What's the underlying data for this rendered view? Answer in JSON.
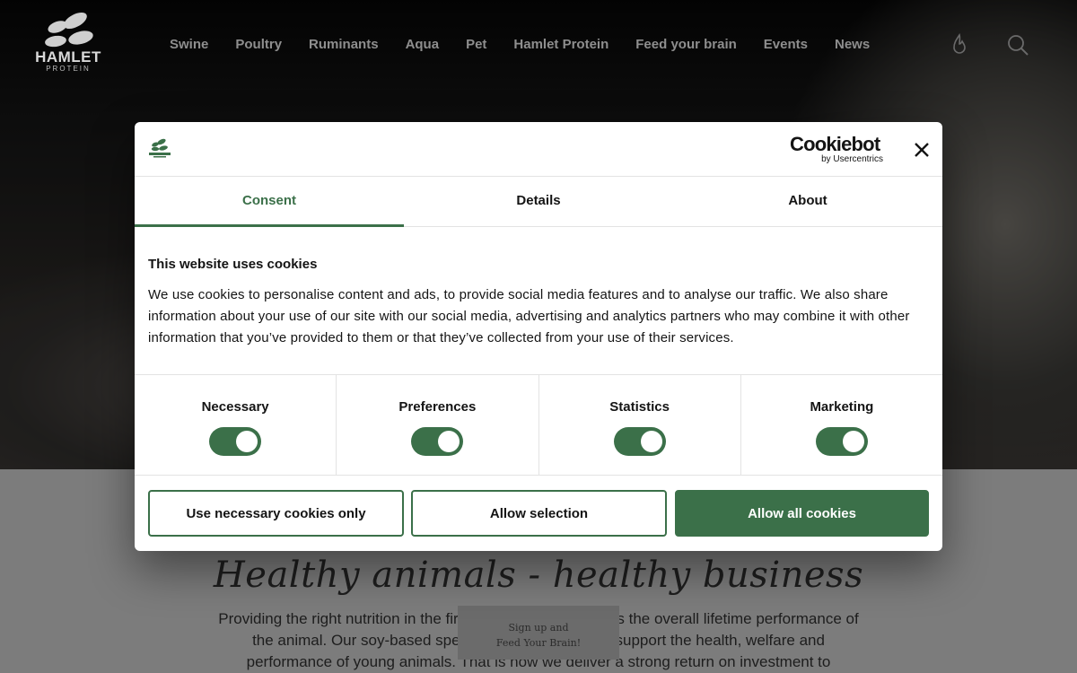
{
  "header": {
    "logo_word": "HAMLET",
    "logo_sub": "PROTEIN",
    "nav": [
      "Swine",
      "Poultry",
      "Ruminants",
      "Aqua",
      "Pet",
      "Hamlet Protein",
      "Feed your brain",
      "Events",
      "News"
    ],
    "icons": [
      "flame-icon",
      "search-icon"
    ]
  },
  "dialog": {
    "brand_name": "Cookiebot",
    "brand_by": "by Usercentrics",
    "tabs": [
      "Consent",
      "Details",
      "About"
    ],
    "active_tab": "Consent",
    "heading": "This website uses cookies",
    "text": "We use cookies to personalise content and ads, to provide social media features and to analyse our traffic. We also share information about your use of our site with our social media, advertising and analytics partners who may combine it with other information that you’ve provided to them or that they’ve collected from your use of their services.",
    "categories": [
      {
        "label": "Necessary",
        "on": true
      },
      {
        "label": "Preferences",
        "on": true
      },
      {
        "label": "Statistics",
        "on": true
      },
      {
        "label": "Marketing",
        "on": true
      }
    ],
    "buttons": {
      "necessary_only": "Use necessary cookies only",
      "allow_selection": "Allow selection",
      "allow_all": "Allow all cookies"
    },
    "accent": "#3b7049"
  },
  "page": {
    "headline": "Healthy animals - healthy business",
    "paragraph": "Providing the right nutrition in the first weeks of life improves the overall lifetime performance of the animal. Our soy-based speciality feed ingredients support the health, welfare and performance of young animals. That is how we deliver a strong return on investment to producers around the",
    "signup_line1": "Sign up and",
    "signup_line2": "Feed Your Brain!"
  }
}
